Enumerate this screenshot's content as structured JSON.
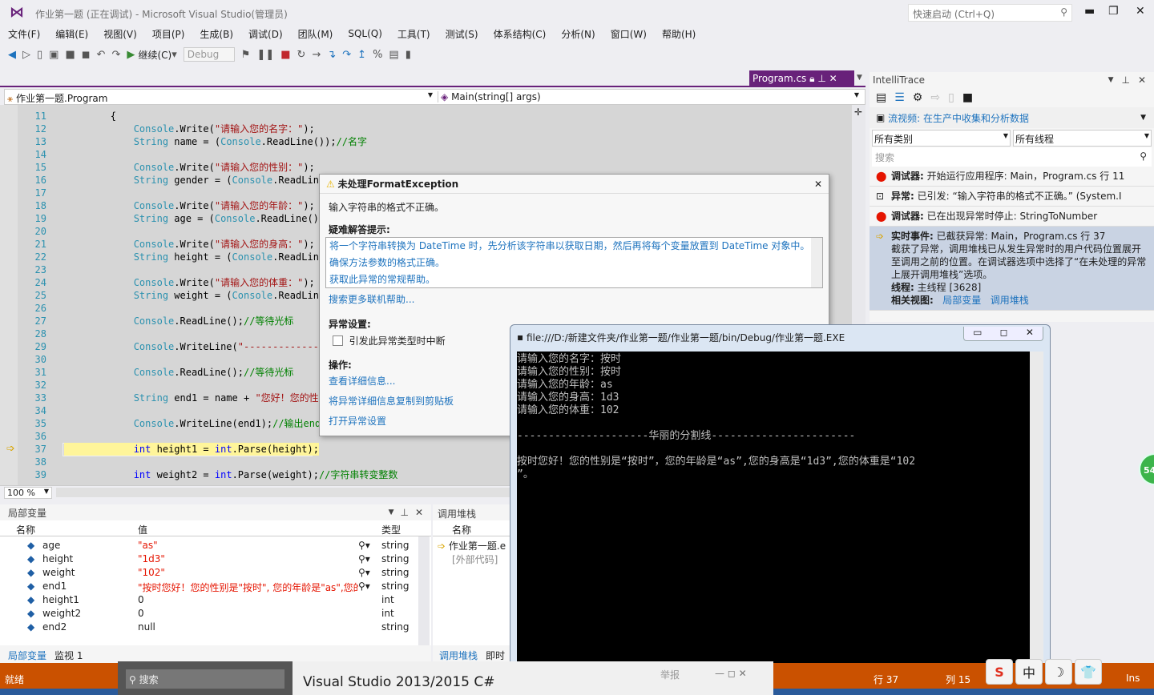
{
  "window": {
    "title": "作业第一题 (正在调试) - Microsoft Visual Studio(管理员)",
    "quick_launch_placeholder": "快速启动 (Ctrl+Q)"
  },
  "menu": [
    "文件(F)",
    "编辑(E)",
    "视图(V)",
    "项目(P)",
    "生成(B)",
    "调试(D)",
    "团队(M)",
    "SQL(Q)",
    "工具(T)",
    "测试(S)",
    "体系结构(C)",
    "分析(N)",
    "窗口(W)",
    "帮助(H)"
  ],
  "toolbar": {
    "continue_label": "继续(C)",
    "config": "Debug"
  },
  "editor": {
    "tab": "Program.cs",
    "nav_class": "作业第一题.Program",
    "nav_member": "Main(string[] args)",
    "zoom": "100 %",
    "current_line": 37,
    "lines": [
      {
        "n": "11",
        "seg": [
          {
            "c": "p",
            "t": "        {"
          }
        ]
      },
      {
        "n": "12",
        "seg": [
          {
            "c": "p",
            "t": "            "
          },
          {
            "c": "t",
            "t": "Console"
          },
          {
            "c": "p",
            "t": ".Write("
          },
          {
            "c": "s",
            "t": "\"请输入您的名字：\""
          },
          {
            "c": "p",
            "t": ");"
          }
        ]
      },
      {
        "n": "13",
        "seg": [
          {
            "c": "p",
            "t": "            "
          },
          {
            "c": "t",
            "t": "String"
          },
          {
            "c": "p",
            "t": " name = ("
          },
          {
            "c": "t",
            "t": "Console"
          },
          {
            "c": "p",
            "t": ".ReadLine());"
          },
          {
            "c": "c",
            "t": "//名字"
          }
        ]
      },
      {
        "n": "14",
        "seg": []
      },
      {
        "n": "15",
        "seg": [
          {
            "c": "p",
            "t": "            "
          },
          {
            "c": "t",
            "t": "Console"
          },
          {
            "c": "p",
            "t": ".Write("
          },
          {
            "c": "s",
            "t": "\"请输入您的性别：\""
          },
          {
            "c": "p",
            "t": ");"
          }
        ]
      },
      {
        "n": "16",
        "seg": [
          {
            "c": "p",
            "t": "            "
          },
          {
            "c": "t",
            "t": "String"
          },
          {
            "c": "p",
            "t": " gender = ("
          },
          {
            "c": "t",
            "t": "Console"
          },
          {
            "c": "p",
            "t": ".ReadLine"
          }
        ]
      },
      {
        "n": "17",
        "seg": []
      },
      {
        "n": "18",
        "seg": [
          {
            "c": "p",
            "t": "            "
          },
          {
            "c": "t",
            "t": "Console"
          },
          {
            "c": "p",
            "t": ".Write("
          },
          {
            "c": "s",
            "t": "\"请输入您的年龄：\""
          },
          {
            "c": "p",
            "t": ");"
          }
        ]
      },
      {
        "n": "19",
        "seg": [
          {
            "c": "p",
            "t": "            "
          },
          {
            "c": "t",
            "t": "String"
          },
          {
            "c": "p",
            "t": " age = ("
          },
          {
            "c": "t",
            "t": "Console"
          },
          {
            "c": "p",
            "t": ".ReadLine())"
          }
        ]
      },
      {
        "n": "20",
        "seg": []
      },
      {
        "n": "21",
        "seg": [
          {
            "c": "p",
            "t": "            "
          },
          {
            "c": "t",
            "t": "Console"
          },
          {
            "c": "p",
            "t": ".Write("
          },
          {
            "c": "s",
            "t": "\"请输入您的身高：\""
          },
          {
            "c": "p",
            "t": ");"
          }
        ]
      },
      {
        "n": "22",
        "seg": [
          {
            "c": "p",
            "t": "            "
          },
          {
            "c": "t",
            "t": "String"
          },
          {
            "c": "p",
            "t": " height = ("
          },
          {
            "c": "t",
            "t": "Console"
          },
          {
            "c": "p",
            "t": ".ReadLine"
          }
        ]
      },
      {
        "n": "23",
        "seg": []
      },
      {
        "n": "24",
        "seg": [
          {
            "c": "p",
            "t": "            "
          },
          {
            "c": "t",
            "t": "Console"
          },
          {
            "c": "p",
            "t": ".Write("
          },
          {
            "c": "s",
            "t": "\"请输入您的体重：\""
          },
          {
            "c": "p",
            "t": ");"
          }
        ]
      },
      {
        "n": "25",
        "seg": [
          {
            "c": "p",
            "t": "            "
          },
          {
            "c": "t",
            "t": "String"
          },
          {
            "c": "p",
            "t": " weight = ("
          },
          {
            "c": "t",
            "t": "Console"
          },
          {
            "c": "p",
            "t": ".ReadLine"
          }
        ]
      },
      {
        "n": "26",
        "seg": []
      },
      {
        "n": "27",
        "seg": [
          {
            "c": "p",
            "t": "            "
          },
          {
            "c": "t",
            "t": "Console"
          },
          {
            "c": "p",
            "t": ".ReadLine();"
          },
          {
            "c": "c",
            "t": "//等待光标"
          }
        ]
      },
      {
        "n": "28",
        "seg": []
      },
      {
        "n": "29",
        "seg": [
          {
            "c": "p",
            "t": "            "
          },
          {
            "c": "t",
            "t": "Console"
          },
          {
            "c": "p",
            "t": ".WriteLine("
          },
          {
            "c": "s",
            "t": "\"--------------------"
          }
        ]
      },
      {
        "n": "30",
        "seg": []
      },
      {
        "n": "31",
        "seg": [
          {
            "c": "p",
            "t": "            "
          },
          {
            "c": "t",
            "t": "Console"
          },
          {
            "c": "p",
            "t": ".ReadLine();"
          },
          {
            "c": "c",
            "t": "//等待光标"
          }
        ]
      },
      {
        "n": "32",
        "seg": []
      },
      {
        "n": "33",
        "seg": [
          {
            "c": "p",
            "t": "            "
          },
          {
            "c": "t",
            "t": "String"
          },
          {
            "c": "p",
            "t": " end1 = name + "
          },
          {
            "c": "s",
            "t": "\"您好！您的性"
          }
        ]
      },
      {
        "n": "34",
        "seg": []
      },
      {
        "n": "35",
        "seg": [
          {
            "c": "p",
            "t": "            "
          },
          {
            "c": "t",
            "t": "Console"
          },
          {
            "c": "p",
            "t": ".WriteLine(end1);"
          },
          {
            "c": "c",
            "t": "//输出end1"
          }
        ]
      },
      {
        "n": "36",
        "seg": []
      },
      {
        "n": "37",
        "seg": [
          {
            "c": "p",
            "t": "            "
          },
          {
            "c": "k",
            "t": "int"
          },
          {
            "c": "p",
            "t": " height1 = "
          },
          {
            "c": "k",
            "t": "int"
          },
          {
            "c": "p",
            "t": ".Parse(height);"
          }
        ]
      },
      {
        "n": "38",
        "seg": []
      },
      {
        "n": "39",
        "seg": [
          {
            "c": "p",
            "t": "            "
          },
          {
            "c": "k",
            "t": "int"
          },
          {
            "c": "p",
            "t": " weight2 = "
          },
          {
            "c": "k",
            "t": "int"
          },
          {
            "c": "p",
            "t": ".Parse(weight);"
          },
          {
            "c": "c",
            "t": "//字符串转变整数"
          }
        ]
      }
    ]
  },
  "exception": {
    "title": "未处理FormatException",
    "message": "输入字符串的格式不正确。",
    "tips_heading": "疑难解答提示:",
    "tips": [
      "将一个字符串转换为 DateTime 时，先分析该字符串以获取日期，然后再将每个变量放置到 DateTime 对象中。",
      "确保方法参数的格式正确。",
      "获取此异常的常规帮助。"
    ],
    "search_more": "搜索更多联机帮助...",
    "settings_heading": "异常设置:",
    "break_checkbox": "引发此异常类型时中断",
    "break_checked": false,
    "actions_heading": "操作:",
    "actions": [
      "查看详细信息...",
      "将异常详细信息复制到剪贴板",
      "打开异常设置"
    ]
  },
  "locals": {
    "title": "局部变量",
    "columns": [
      "名称",
      "值",
      "类型"
    ],
    "rows": [
      {
        "name": "age",
        "value": "\"as\"",
        "type": "string",
        "str": true
      },
      {
        "name": "height",
        "value": "\"1d3\"",
        "type": "string",
        "str": true
      },
      {
        "name": "weight",
        "value": "\"102\"",
        "type": "string",
        "str": true
      },
      {
        "name": "end1",
        "value": "\"按时您好！您的性别是\"按时\", 您的年龄是\"as\",您的",
        "type": "string",
        "str": true
      },
      {
        "name": "height1",
        "value": "0",
        "type": "int",
        "str": false
      },
      {
        "name": "weight2",
        "value": "0",
        "type": "int",
        "str": false
      },
      {
        "name": "end2",
        "value": "null",
        "type": "string",
        "str": false
      }
    ],
    "tabs": [
      "局部变量",
      "监视 1"
    ]
  },
  "callstack": {
    "title": "调用堆栈",
    "column": "名称",
    "rows": [
      "作业第一题.e",
      "[外部代码]"
    ],
    "tabs": [
      "调用堆栈",
      "即时"
    ]
  },
  "intellitrace": {
    "title": "IntelliTrace",
    "stream_link": "流视频: 在生产中收集和分析数据",
    "category_filter": "所有类别",
    "thread_filter": "所有线程",
    "search_placeholder": "搜索",
    "events": [
      {
        "label": "调试器:",
        "text": "开始运行应用程序: Main，Program.cs 行 11",
        "icon": "stop-icon"
      },
      {
        "label": "异常:",
        "text": "已引发: “输入字符串的格式不正确。” (System.I",
        "icon": "exception-icon"
      },
      {
        "label": "调试器:",
        "text": "已在出现异常时停止: StringToNumber",
        "icon": "stop-icon"
      }
    ],
    "live_event": {
      "label": "实时事件:",
      "text": "已截获异常: Main，Program.cs 行 37",
      "detail": "截获了异常，调用堆栈已从发生异常时的用户代码位置展开至调用之前的位置。在调试器选项中选择了“在未处理的异常上展开调用堆栈”选项。",
      "thread_label": "线程:",
      "thread": "主线程 [3628]",
      "related_label": "相关视图:",
      "related": [
        "局部变量",
        "调用堆栈"
      ]
    }
  },
  "console": {
    "title": "file:///D:/新建文件夹/作业第一题/作业第一题/bin/Debug/作业第一题.EXE",
    "lines": [
      "请输入您的名字：按时",
      "请输入您的性别：按时",
      "请输入您的年龄：as",
      "请输入您的身高：1d3",
      "请输入您的体重：102",
      "",
      "---------------------华丽的分割线-----------------------",
      "",
      "按时您好！您的性别是“按时”，您的年龄是“as”,您的身高是“1d3”,您的体重是“102",
      "”。"
    ]
  },
  "statusbar": {
    "status": "就绪",
    "line": "行 37",
    "col": "列 15",
    "mode": "Ins"
  },
  "popup": {
    "search": "搜索",
    "title": "Visual Studio 2013/2015 C#",
    "report": "举报"
  },
  "ime": [
    "S",
    "中",
    "☽",
    "👕"
  ],
  "badge": "54",
  "colors": {
    "accent": "#68217a",
    "status": "#ca5100",
    "string": "#a31515",
    "type": "#2b91af",
    "comment": "#008000",
    "keyword": "#0000ff"
  }
}
